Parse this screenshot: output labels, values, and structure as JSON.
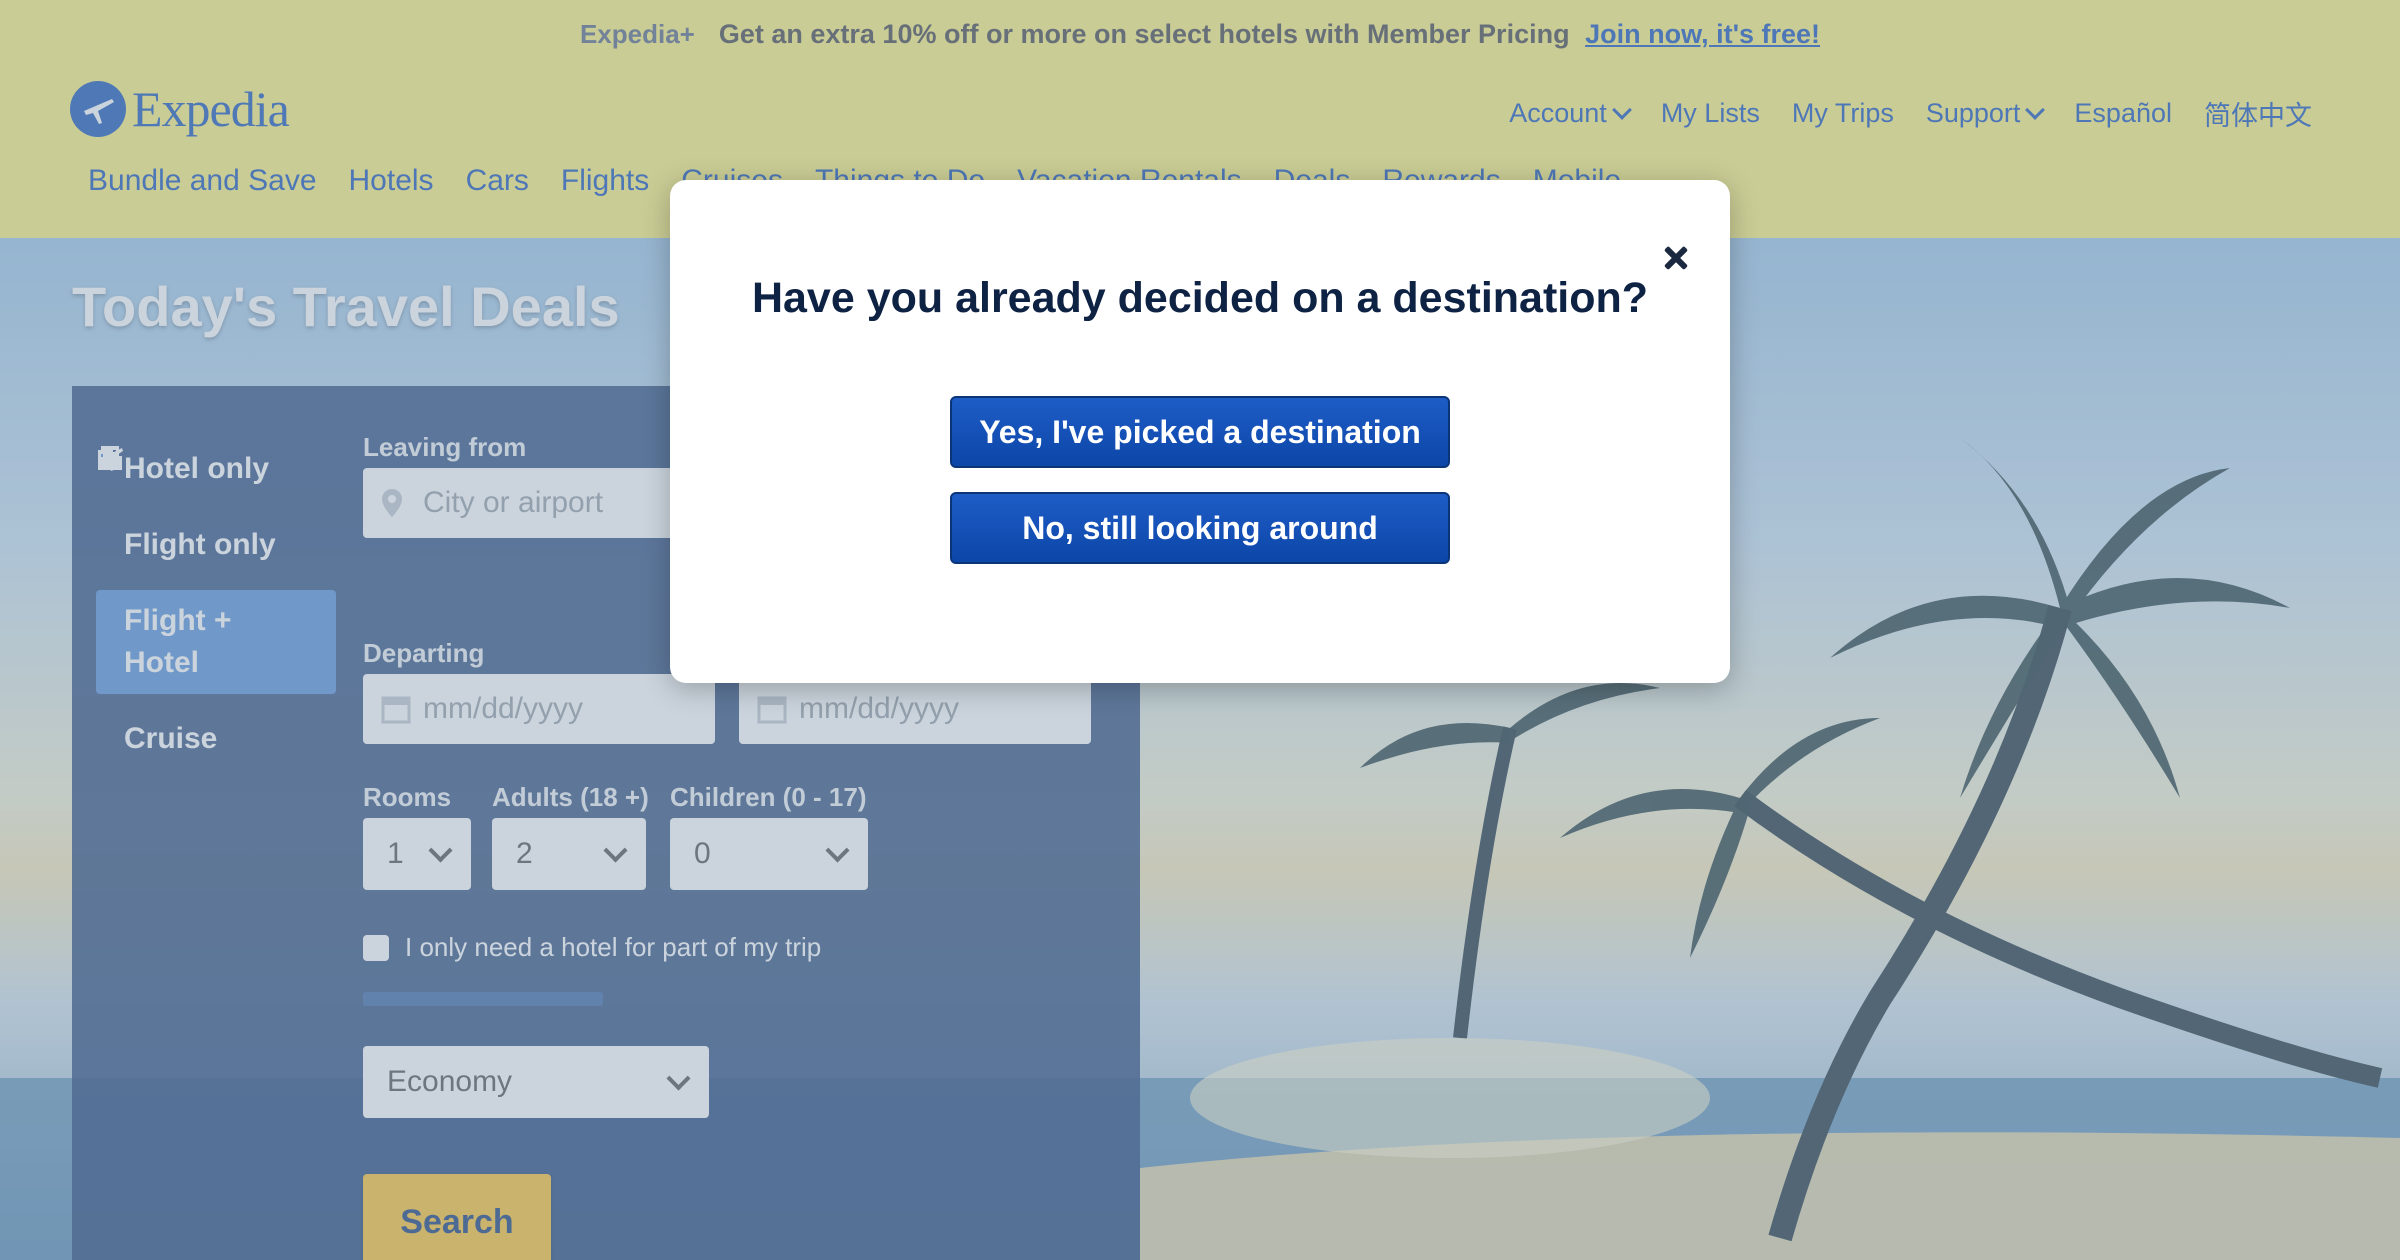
{
  "promo": {
    "logo": "Expedia+",
    "text": "Get an extra 10% off or more on select hotels with Member Pricing",
    "link": "Join now, it's free!"
  },
  "header": {
    "logo_text": "Expedia",
    "top_nav": [
      "Account",
      "My Lists",
      "My Trips",
      "Support",
      "Español",
      "简体中文"
    ],
    "main_nav": [
      "Bundle and Save",
      "Hotels",
      "Cars",
      "Flights",
      "Cruises",
      "Things to Do",
      "Vacation Rentals",
      "Deals",
      "Rewards",
      "Mobile"
    ]
  },
  "hero": {
    "title": "Today's Travel Deals"
  },
  "search": {
    "modes": [
      {
        "label": "Hotel only",
        "icon": "building-icon"
      },
      {
        "label": "Flight only",
        "icon": "airplane-icon"
      },
      {
        "label": "Flight + Hotel",
        "icon": "flight-hotel-icon",
        "active": true
      },
      {
        "label": "Cruise",
        "icon": "cruise-icon"
      }
    ],
    "leaving_from_label": "Leaving from",
    "leaving_from_placeholder": "City or airport",
    "departing_label": "Departing",
    "date_placeholder": "mm/dd/yyyy",
    "rooms_label": "Rooms",
    "rooms_value": "1",
    "adults_label": "Adults (18 +)",
    "adults_value": "2",
    "children_label": "Children (0 - 17)",
    "children_value": "0",
    "partial_hotel_label": "I only need a hotel for part of my trip",
    "cabin_value": "Economy",
    "search_button": "Search"
  },
  "modal": {
    "title": "Have you already decided on a destination?",
    "yes_button": "Yes, I've picked a destination",
    "no_button": "No, still looking around"
  },
  "colors": {
    "brand_yellow": "#fef07c",
    "brand_blue": "#1d5ab8",
    "modal_button": "#0c46a8",
    "search_button": "#fec433"
  }
}
